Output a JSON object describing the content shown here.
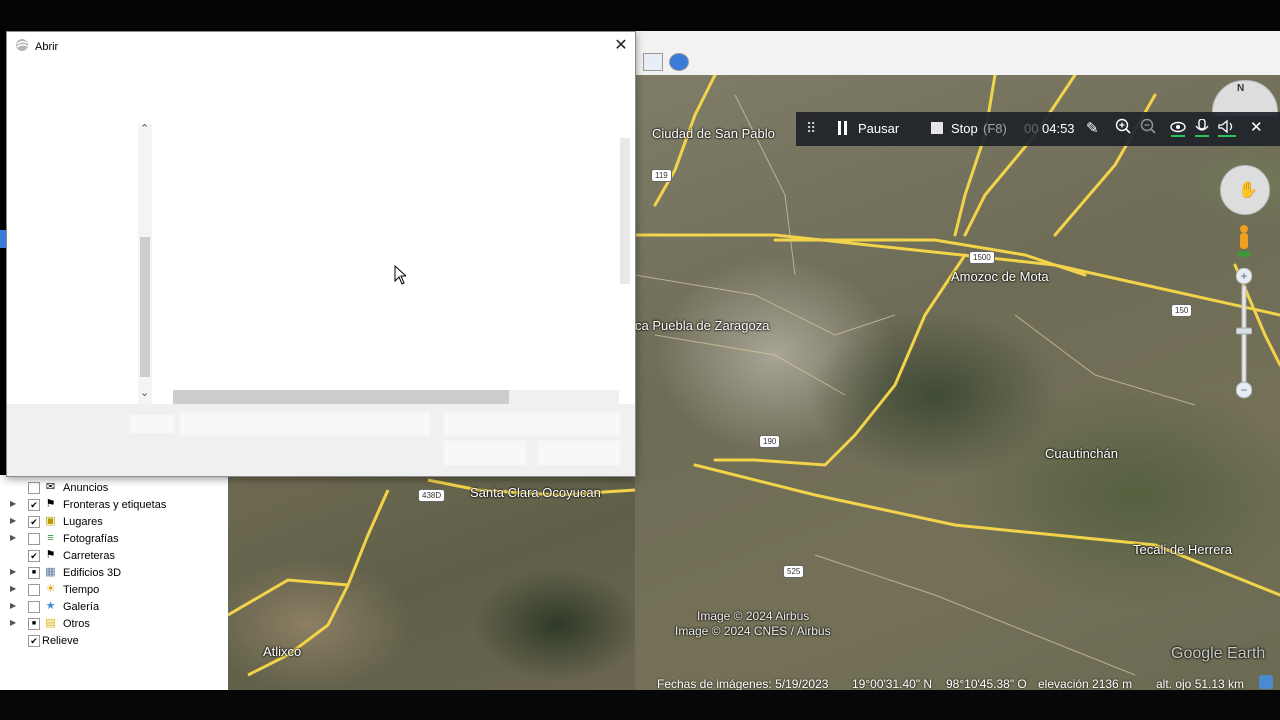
{
  "dialog": {
    "title": "Abrir",
    "close_glyph": "✕"
  },
  "recorder": {
    "pause_label": "Pausar",
    "stop_label": "Stop",
    "stop_shortcut": "(F8)",
    "timer_prefix": "00",
    "timer": "04:53"
  },
  "map": {
    "labels": [
      "Ciudad de San Pablo",
      "Amozoc de Mota",
      "ca Puebla de Zaragoza",
      "Cuautinchán",
      "Tecali de Herrera",
      "Santa Clara Ocoyucan",
      "Atlixco"
    ],
    "shields": [
      "119",
      "1500",
      "150",
      "190",
      "438D",
      "525"
    ],
    "attribution": [
      "Image © 2024 Airbus",
      "Image © 2024 CNES / Airbus"
    ],
    "watermark": "Google Earth",
    "compass_letter": "N"
  },
  "status": {
    "imagery_date": "Fechas de imágenes: 5/19/2023",
    "lat": "19°00'31.40\" N",
    "lon": "98°10'45.38\" O",
    "elevation": "elevación  2136 m",
    "eye_alt": "alt. ojo  51.13 km"
  },
  "layers": [
    {
      "label": "Anuncios",
      "checked": "",
      "icon": "✉"
    },
    {
      "label": "Fronteras y etiquetas",
      "checked": "✔",
      "icon": "⚑"
    },
    {
      "label": "Lugares",
      "checked": "✔",
      "icon": "▣"
    },
    {
      "label": "Fotografías",
      "checked": "",
      "icon": "≡"
    },
    {
      "label": "Carreteras",
      "checked": "✔",
      "icon": "⚑"
    },
    {
      "label": "Edificios 3D",
      "checked": "■",
      "icon": "▦"
    },
    {
      "label": "Tiempo",
      "checked": "",
      "icon": "☀"
    },
    {
      "label": "Galería",
      "checked": "",
      "icon": "★"
    },
    {
      "label": "Otros",
      "checked": "■",
      "icon": "▤"
    },
    {
      "label": "Relieve",
      "checked": "✔",
      "icon": ""
    }
  ],
  "scrollbar_glyphs": {
    "up": "⌃",
    "down": "⌄"
  }
}
